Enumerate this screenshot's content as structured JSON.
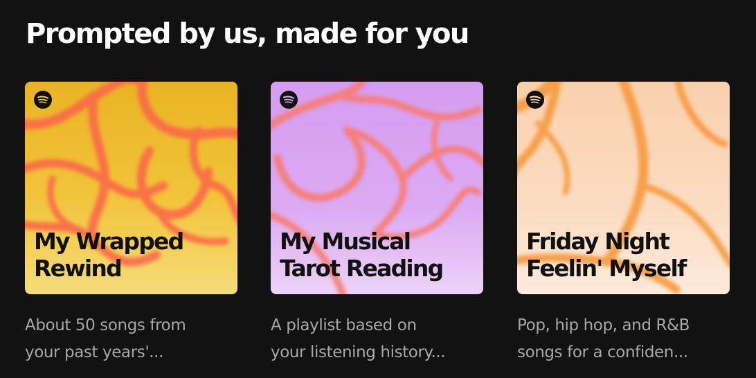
{
  "section": {
    "title": "Prompted by us, made for you"
  },
  "colors": {
    "background": "#121212",
    "title": "#ffffff",
    "description": "#a7a7a7"
  },
  "cards": [
    {
      "title_lines": [
        "My Wrapped",
        "Rewind"
      ],
      "description_lines": [
        "About 50 songs from",
        "your past years'..."
      ],
      "logo_icon": "spotify-logo-icon",
      "palette": {
        "base": "#f2c43a",
        "blob": "#f4d35a",
        "lines": "#fb6a4a",
        "title": "#111111"
      }
    },
    {
      "title_lines": [
        "My Musical",
        "Tarot Reading"
      ],
      "description_lines": [
        "A playlist based on",
        "your listening history..."
      ],
      "logo_icon": "spotify-logo-icon",
      "palette": {
        "base": "#dba7f2",
        "blob": "#e7c2f6",
        "lines": "#f97b70",
        "title": "#111111"
      }
    },
    {
      "title_lines": [
        "Friday Night",
        "Feelin' Myself"
      ],
      "description_lines": [
        "Pop, hip hop, and R&B",
        "songs for a confiden..."
      ],
      "logo_icon": "spotify-logo-icon",
      "palette": {
        "base": "#fbdcc2",
        "blob": "#fde8d5",
        "lines": "#f79a3c",
        "title": "#111111"
      }
    }
  ]
}
